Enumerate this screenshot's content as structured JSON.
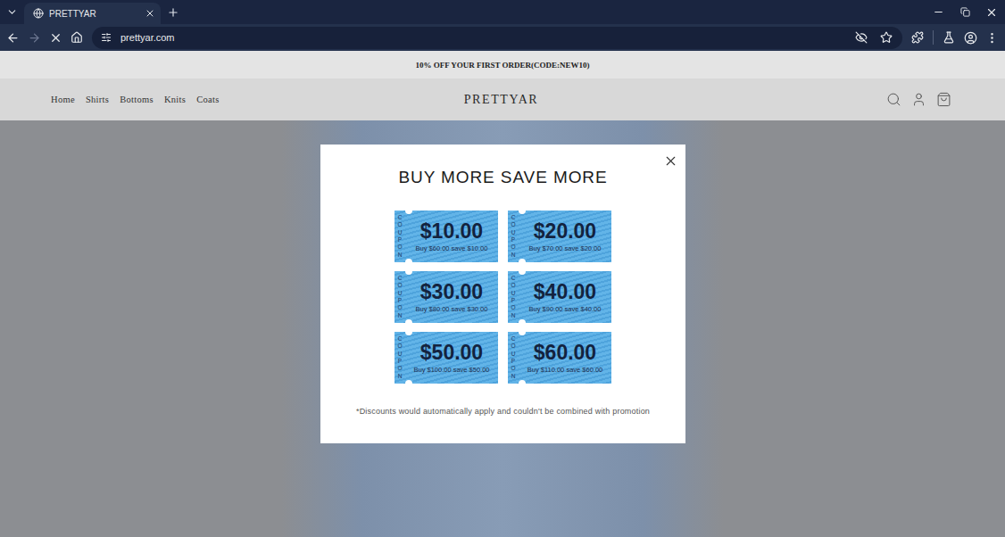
{
  "browser": {
    "tabs": [
      {
        "title": "PRETTYAR",
        "selected": true
      }
    ],
    "url": "prettyar.com",
    "loading": true,
    "forward_enabled": false
  },
  "page": {
    "announcement": "10% OFF YOUR FIRST ORDER(CODE:NEW10)",
    "nav": [
      "Home",
      "Shirts",
      "Bottoms",
      "Knits",
      "Coats"
    ],
    "logo": "PRETTYAR"
  },
  "modal": {
    "title": "BUY MORE SAVE MORE",
    "coupons": [
      {
        "side_label": "COUPON",
        "amount": "$10.00",
        "terms": "Buy $60.00 save $10.00"
      },
      {
        "side_label": "COUPON",
        "amount": "$20.00",
        "terms": "Buy $70.00 save $20.00"
      },
      {
        "side_label": "COUPON",
        "amount": "$30.00",
        "terms": "Buy $80.00 save $30.00"
      },
      {
        "side_label": "COUPON",
        "amount": "$40.00",
        "terms": "Buy $90.00 save $40.00"
      },
      {
        "side_label": "COUPON",
        "amount": "$50.00",
        "terms": "Buy $100.00 save $50.00"
      },
      {
        "side_label": "COUPON",
        "amount": "$60.00",
        "terms": "Buy $110.00 save $60.00"
      }
    ],
    "note": "*Discounts would automatically apply and couldn't be combined with promotion"
  }
}
